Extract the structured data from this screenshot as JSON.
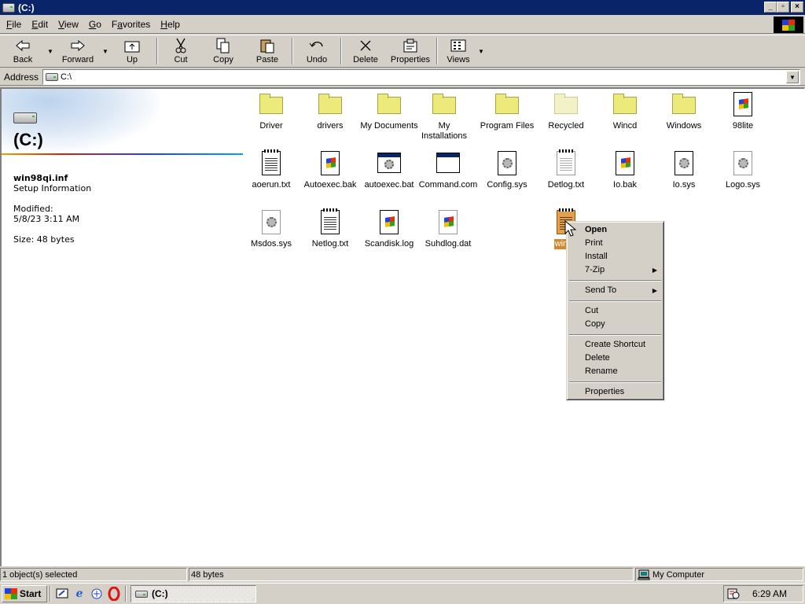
{
  "window": {
    "title": "(C:)"
  },
  "menu": [
    {
      "label": "File",
      "key": "F",
      "rest": "ile"
    },
    {
      "label": "Edit",
      "key": "E",
      "rest": "dit"
    },
    {
      "label": "View",
      "key": "V",
      "rest": "iew"
    },
    {
      "label": "Go",
      "key": "G",
      "rest": "o"
    },
    {
      "label": "Favorites",
      "key": "a",
      "pre": "F",
      "rest": "vorites"
    },
    {
      "label": "Help",
      "key": "H",
      "rest": "elp"
    }
  ],
  "toolbar": {
    "back": "Back",
    "forward": "Forward",
    "up": "Up",
    "cut": "Cut",
    "copy": "Copy",
    "paste": "Paste",
    "undo": "Undo",
    "delete": "Delete",
    "properties": "Properties",
    "views": "Views"
  },
  "address": {
    "label": "Address",
    "value": "C:\\"
  },
  "panel": {
    "title": "(C:)",
    "file_name": "win98qi.inf",
    "file_type": "Setup Information",
    "modified_label": "Modified:",
    "modified_value": "5/8/23 3:11 AM",
    "size": "Size: 48 bytes"
  },
  "files": [
    {
      "name": "Driver",
      "icon": "folder-icon"
    },
    {
      "name": "drivers",
      "icon": "folder-icon"
    },
    {
      "name": "My Documents",
      "icon": "folder-icon"
    },
    {
      "name": "My Installations",
      "icon": "folder-icon"
    },
    {
      "name": "Program Files",
      "icon": "folder-icon"
    },
    {
      "name": "Recycled",
      "icon": "folder-icon"
    },
    {
      "name": "Wincd",
      "icon": "folder-icon"
    },
    {
      "name": "Windows",
      "icon": "folder-icon"
    },
    {
      "name": "98lite",
      "icon": "windows-file-icon"
    },
    {
      "name": "aoerun.txt",
      "icon": "notepad-icon"
    },
    {
      "name": "Autoexec.bak",
      "icon": "windows-file-icon"
    },
    {
      "name": "autoexec.bat",
      "icon": "batch-file-icon"
    },
    {
      "name": "Command.com",
      "icon": "program-icon"
    },
    {
      "name": "Config.sys",
      "icon": "system-file-icon"
    },
    {
      "name": "Detlog.txt",
      "icon": "notepad-icon"
    },
    {
      "name": "Io.bak",
      "icon": "windows-file-icon"
    },
    {
      "name": "Io.sys",
      "icon": "system-file-icon"
    },
    {
      "name": "Logo.sys",
      "icon": "system-file-icon"
    },
    {
      "name": "Msdos.sys",
      "icon": "system-file-icon"
    },
    {
      "name": "Netlog.txt",
      "icon": "notepad-icon"
    },
    {
      "name": "Scandisk.log",
      "icon": "windows-file-icon"
    },
    {
      "name": "Suhdlog.dat",
      "icon": "windows-file-icon"
    },
    {
      "name": "win98qi.inf",
      "visible_label": "win98",
      "icon": "setup-info-icon",
      "selected": true
    }
  ],
  "context_menu": {
    "open": "Open",
    "print": "Print",
    "install": "Install",
    "zip": "7-Zip",
    "send_to": "Send To",
    "cut": "Cut",
    "copy": "Copy",
    "create_shortcut": "Create Shortcut",
    "delete": "Delete",
    "rename": "Rename",
    "properties": "Properties"
  },
  "status": {
    "selected": "1 object(s) selected",
    "size": "48 bytes",
    "zone": "My Computer"
  },
  "taskbar": {
    "start": "Start",
    "task": "(C:)",
    "clock": "6:29 AM"
  }
}
